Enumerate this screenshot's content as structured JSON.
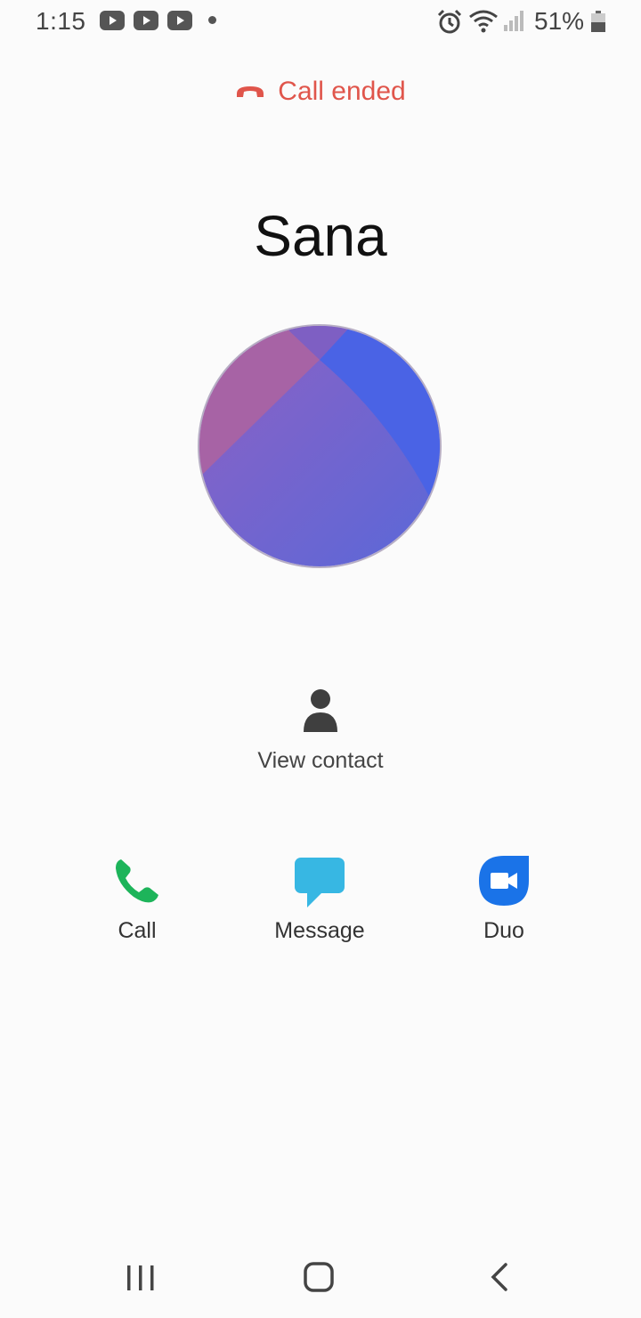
{
  "status_bar": {
    "time": "1:15",
    "battery": "51%",
    "icons": [
      "youtube-icon",
      "youtube-icon",
      "youtube-icon",
      "notification-dot",
      "alarm-icon",
      "wifi-icon",
      "signal-icon",
      "battery-icon"
    ]
  },
  "call": {
    "status": "Call ended",
    "status_color": "#e0554b",
    "contact_name": "Sana"
  },
  "view_contact": {
    "label": "View contact",
    "icon": "person-icon"
  },
  "actions": [
    {
      "label": "Call",
      "icon": "phone-icon",
      "color": "#1db45a"
    },
    {
      "label": "Message",
      "icon": "message-icon",
      "color": "#37b7e3"
    },
    {
      "label": "Duo",
      "icon": "duo-video-icon",
      "color": "#1a73e8"
    }
  ],
  "nav_bar": {
    "buttons": [
      "recent-apps-icon",
      "home-icon",
      "back-icon"
    ]
  }
}
